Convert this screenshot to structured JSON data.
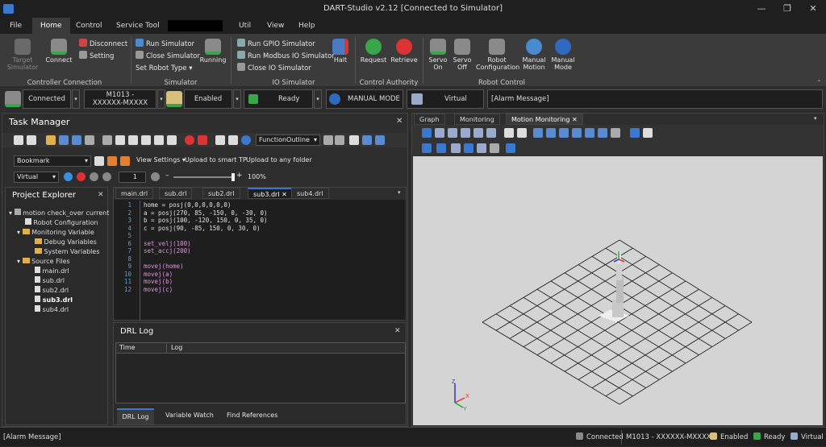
{
  "window": {
    "title": "DART-Studio v2.12 [Connected to Simulator]"
  },
  "menu": [
    "File",
    "Home",
    "Control",
    "Service Tool",
    "",
    "Util",
    "View",
    "Help"
  ],
  "ribbon": {
    "target_simulator": "Target Simulator",
    "connect": "Connect",
    "disconnect": "Disconnect",
    "setting": "Setting",
    "group_controller": "Controller Connection",
    "run_simulator": "Run Simulator",
    "close_simulator": "Close Simulator",
    "set_robot_type": "Set Robot Type",
    "running": "Running",
    "group_simulator": "Simulator",
    "run_gpio": "Run GPIO Simulator",
    "run_modbus": "Run Modbus IO Simulator",
    "close_io": "Close IO Simulator",
    "halt": "Halt",
    "group_io": "IO Simulator",
    "request": "Request",
    "retrieve": "Retrieve",
    "group_authority": "Control Authority",
    "servo_on": "Servo On",
    "servo_off": "Servo Off",
    "robot_config": "Robot Configuration",
    "manual_motion": "Manual Motion",
    "manual_mode": "Manual Mode",
    "group_robot": "Robot Control"
  },
  "status": {
    "connected": "Connected",
    "model_line1": "M1013 -",
    "model_line2": "XXXXXX-MXXXX",
    "enabled": "Enabled",
    "ready": "Ready",
    "manual_mode": "MANUAL MODE",
    "virtual": "Virtual",
    "alarm": "[Alarm Message]"
  },
  "task_manager": {
    "title": "Task Manager",
    "function_outline": "FunctionOutline",
    "bookmark": "Bookmark",
    "view_settings": "View Settings",
    "upload_smart_tp": "Upload to smart TP",
    "upload_folder": "Upload to any folder",
    "mode": "Virtual",
    "step": "1",
    "speed": "100%"
  },
  "project_explorer": {
    "title": "Project Explorer",
    "items": [
      {
        "label": "motion check_over current",
        "level": 0,
        "bold": false
      },
      {
        "label": "Robot Configuration",
        "level": 1,
        "bold": false
      },
      {
        "label": "Monitoring Variable",
        "level": 1,
        "bold": false
      },
      {
        "label": "Debug Variables",
        "level": 2,
        "bold": false
      },
      {
        "label": "System Variables",
        "level": 2,
        "bold": false
      },
      {
        "label": "Source Files",
        "level": 1,
        "bold": false
      },
      {
        "label": "main.drl",
        "level": 2,
        "bold": false
      },
      {
        "label": "sub.drl",
        "level": 2,
        "bold": false
      },
      {
        "label": "sub2.drl",
        "level": 2,
        "bold": false
      },
      {
        "label": "sub3.drl",
        "level": 2,
        "bold": true
      },
      {
        "label": "sub4.drl",
        "level": 2,
        "bold": false
      }
    ]
  },
  "editor": {
    "tabs": [
      "main.drl",
      "sub.drl",
      "sub2.drl",
      "sub3.drl",
      "sub4.drl"
    ],
    "active_tab": "sub3.drl",
    "lines": [
      "home = posj(0,0,0,0,0,0)",
      "a = posj(270, 85, -150, 0, -30, 0)",
      "b = posj(100, -120, 150, 0, 35, 0)",
      "c = posj(90, -85, 150, 0, 30, 0)",
      "",
      "set_velj(100)",
      "set_accj(200)",
      "",
      "movej(home)",
      "movej(a)",
      "movej(b)",
      "movej(c)"
    ],
    "line_numbers": [
      "1",
      "2",
      "3",
      "4",
      "5",
      "6",
      "7",
      "8",
      "9",
      "10",
      "11",
      "12"
    ]
  },
  "drl_log": {
    "title": "DRL Log",
    "col_time": "Time",
    "col_log": "Log",
    "tabs": [
      "DRL Log",
      "Variable Watch",
      "Find References"
    ]
  },
  "right_panel": {
    "tabs": [
      "Graph",
      "Monitoring",
      "Motion Monitoring"
    ],
    "active_tab": "Motion Monitoring"
  },
  "bottom": {
    "alarm": "[Alarm Message]",
    "connected": "Connected",
    "model": "M1013 - XXXXXX-MXXXX",
    "enabled": "Enabled",
    "ready": "Ready",
    "virtual": "Virtual"
  },
  "colors": {
    "accent": "#3a78d0",
    "green": "#3aa64a",
    "red": "#d33"
  }
}
